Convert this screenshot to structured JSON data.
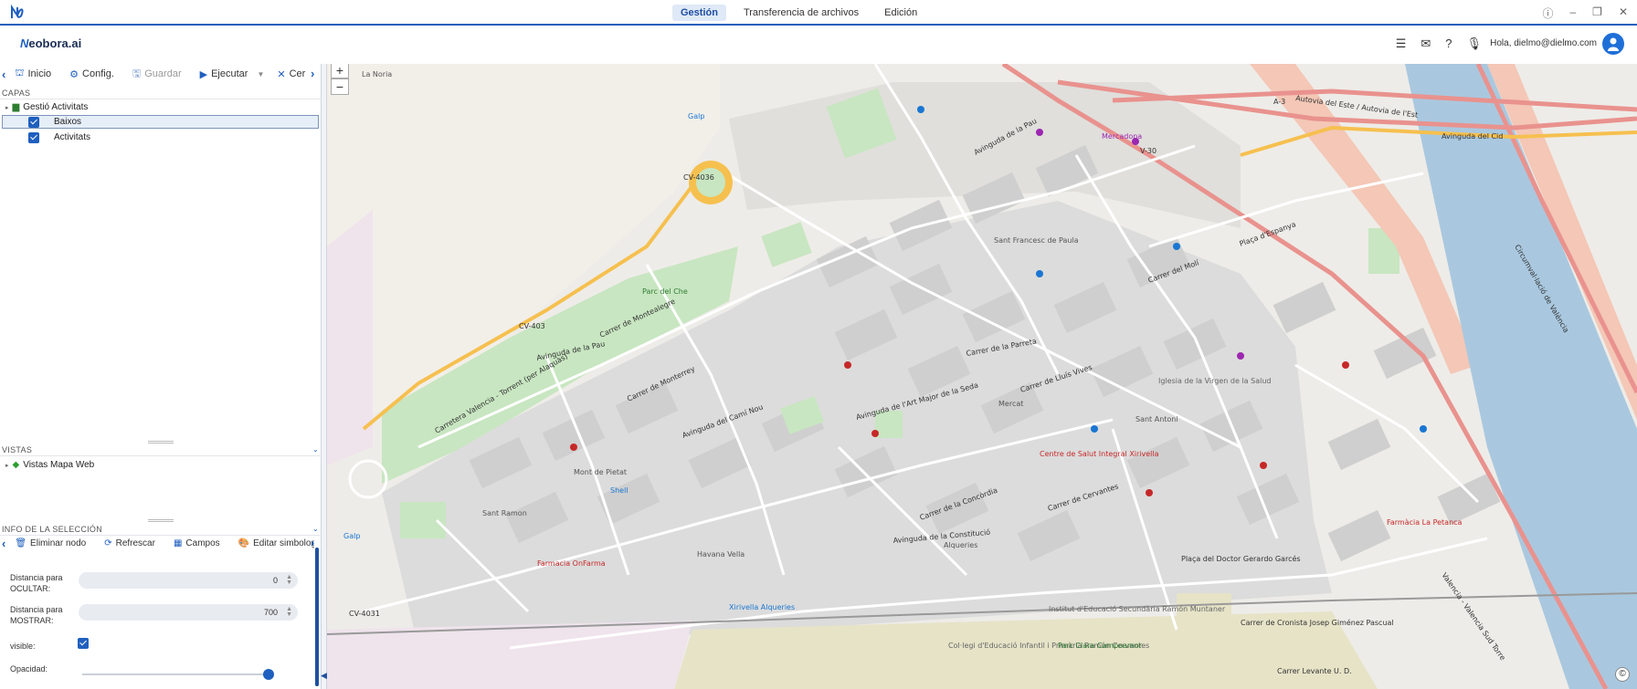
{
  "titlebar": {
    "tabs": [
      {
        "label": "Gestión",
        "active": true
      },
      {
        "label": "Transferencia de archivos",
        "active": false
      },
      {
        "label": "Edición",
        "active": false
      }
    ],
    "window_buttons": [
      "ⓘ",
      "–",
      "❐",
      "✕"
    ]
  },
  "header": {
    "brand_prefix": "N",
    "brand_rest": "eobora.ai",
    "greeting": "Hola, dielmo@dielmo.com",
    "icons": [
      "menu-icon",
      "mail-icon",
      "help-icon",
      "mic-icon",
      "avatar-icon"
    ]
  },
  "toolbar": {
    "items": [
      {
        "label": "Inicio",
        "icon": "home-icon",
        "disabled": false
      },
      {
        "label": "Config.",
        "icon": "gear-icon",
        "disabled": false
      },
      {
        "label": "Guardar",
        "icon": "save-icon",
        "disabled": true
      },
      {
        "label": "Ejecutar",
        "icon": "play-icon",
        "disabled": false
      },
      {
        "label": "Cer",
        "icon": "close-icon",
        "disabled": false
      }
    ]
  },
  "layers": {
    "section_title": "CAPAS",
    "group_label": "Gestió Activitats",
    "items": [
      {
        "label": "Baixos",
        "checked": true,
        "selected": true
      },
      {
        "label": "Activitats",
        "checked": true,
        "selected": false
      }
    ]
  },
  "views": {
    "section_title": "VISTAS",
    "item_label": "Vistas Mapa Web"
  },
  "selection": {
    "section_title": "INFO DE LA SELECCIÓN",
    "actions": [
      {
        "label": "Eliminar nodo",
        "icon": "trash-icon"
      },
      {
        "label": "Refrescar",
        "icon": "refresh-icon"
      },
      {
        "label": "Campos",
        "icon": "table-icon"
      },
      {
        "label": "Editar simbología",
        "icon": "palette-icon"
      }
    ],
    "hide_label_1": "Distancia para",
    "hide_label_2": "OCULTAR:",
    "hide_value": "0",
    "show_label_1": "Distancia para",
    "show_label_2": "MOSTRAR:",
    "show_value": "700",
    "visible_label": "visible:",
    "visible_checked": true,
    "opacity_label": "Opacidad:",
    "opacity_fraction": 1.0
  },
  "map": {
    "zoom_in": "+",
    "zoom_out": "−",
    "attribution": "©",
    "labels": {
      "la_noria": "La Noria",
      "cv4036": "CV-4036",
      "cv403": "CV-403",
      "cv4031": "CV-4031",
      "parc_del_che": "Parc del Che",
      "av_pau_top": "Avinguda de la Pau",
      "av_pau_left": "Avinguda de la Pau",
      "ctra": "Carretera Valencia - Torrent (per Alaquàs)",
      "mont_de_pietat": "Mont de Pietat",
      "sant_ramon": "Sant Ramon",
      "havana_vella": "Havana Vella",
      "sant_francesc": "Sant Francesc de Paula",
      "sant_antoni": "Sant Antoni",
      "mercat": "Mercat",
      "alqueries": "Alqueries",
      "placa_espanya": "Plaça d'Espanya",
      "av_est": "Autovia del Este / Autovia de l'Est",
      "av_cid": "Avinguda del Cid",
      "v30": "V-30",
      "a3": "A-3",
      "av_constitucio": "Avinguda de la Constitució",
      "av_art_major": "Avinguda de l'Art Major de la Seda",
      "av_cami_nou": "Avinguda del Camí Nou",
      "carrer_montealegre": "Carrer de Montealegre",
      "carrer_monterrey": "Carrer de Monterrey",
      "carrer_concordia": "Carrer de la Concòrdia",
      "carrer_cervantes": "Carrer de Cervantes",
      "carrer_moli": "Carrer del Molí",
      "carrer_levante": "Carrer Levante U. D.",
      "carrer_cronista": "Carrer de Cronista Josep Giménez Pascual",
      "carrer_lluis_vives": "Carrer de Lluís Vives",
      "carrer_parreta": "Carrer de la Parreta",
      "circ_valencia": "Circumval·lació de València",
      "placa_doctor": "Plaça del Doctor Gerardo Garcés",
      "iglesia": "Iglesia de la Virgen de la Salud",
      "farmacia_1": "Farmacia OnFarma",
      "farmacia_2": "Farmàcia La Petanca",
      "centro_salud": "Centre de Salut Integral Xirivella",
      "ies": "Institut d'Educació Secundària Ramón Muntaner",
      "colegio": "Col·legi d'Educació Infantil i Primària Ramón Cervantes",
      "xirivella_alqueries": "Xirivella Alqueries",
      "shell": "Shell",
      "galp_1": "Galp",
      "galp_2": "Galp",
      "mercadona": "Mercadona",
      "parc_clara": "Parc Clara Campoamor",
      "valencia_sign": "Valencia - Valencia Sud Torre"
    }
  }
}
